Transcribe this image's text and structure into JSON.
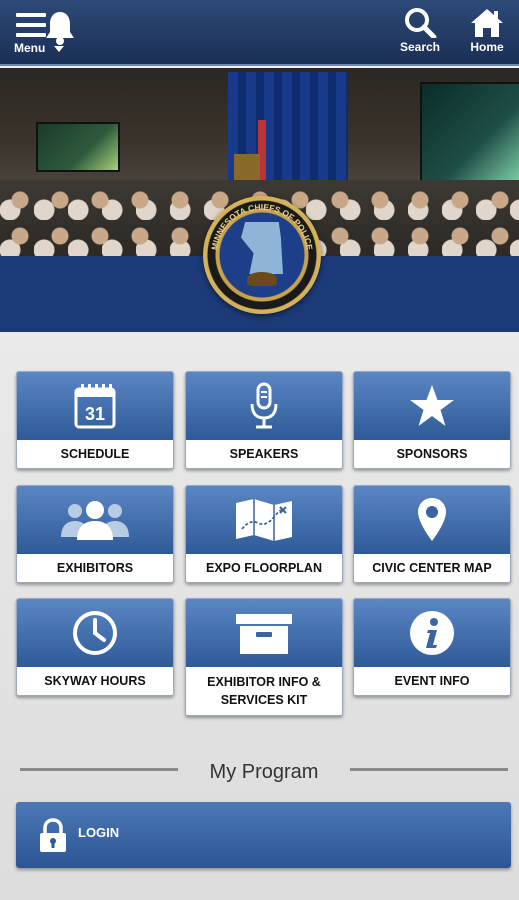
{
  "header": {
    "menu_label": "Menu",
    "search_label": "Search",
    "home_label": "Home",
    "colors": {
      "bar": "#1f3863",
      "accent": "#6d87ad"
    }
  },
  "hero": {
    "seal_text": "MINNESOTA CHIEFS OF POLICE",
    "band_color": "#1c3a78"
  },
  "tiles": [
    {
      "label": "SCHEDULE",
      "icon": "calendar-icon",
      "day": "31"
    },
    {
      "label": "SPEAKERS",
      "icon": "microphone-icon"
    },
    {
      "label": "SPONSORS",
      "icon": "star-icon"
    },
    {
      "label": "EXHIBITORS",
      "icon": "people-icon"
    },
    {
      "label": "EXPO FLOORPLAN",
      "icon": "map-icon"
    },
    {
      "label": "CIVIC CENTER MAP",
      "icon": "map-pin-icon"
    },
    {
      "label": "SKYWAY HOURS",
      "icon": "clock-icon"
    },
    {
      "label": "EXHIBITOR INFO & SERVICES KIT",
      "icon": "archive-box-icon"
    },
    {
      "label": "EVENT INFO",
      "icon": "info-icon"
    }
  ],
  "section": {
    "title": "My Program"
  },
  "login": {
    "label": "LOGIN",
    "icon": "lock-icon"
  }
}
